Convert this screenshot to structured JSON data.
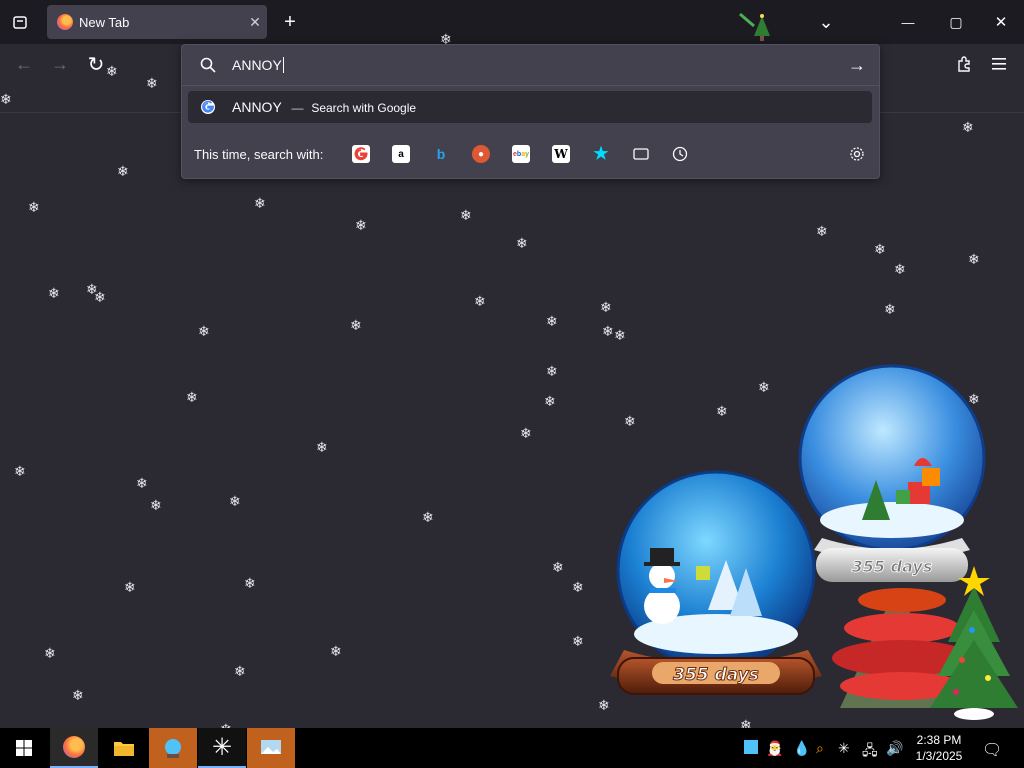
{
  "tab": {
    "title": "New Tab",
    "close": "✕",
    "new_tab": "+"
  },
  "window": {
    "list_all_tabs": "⌄",
    "minimize": "—",
    "maximize": "▢",
    "close": "✕"
  },
  "nav": {
    "back": "←",
    "forward": "→",
    "reload": "↻"
  },
  "urlbar": {
    "value": "ANNOY",
    "go": "→"
  },
  "suggestion": {
    "query": "ANNOY",
    "separator": "—",
    "action": "Search with Google"
  },
  "search_with": {
    "label": "This time, search with:",
    "engines": [
      "google-icon",
      "amazon-icon",
      "bing-icon",
      "duckduckgo-icon",
      "ebay-icon",
      "wikipedia-icon",
      "bookmarks-icon",
      "tabs-icon",
      "history-icon"
    ]
  },
  "globes": {
    "front_label": "355 days",
    "back_label": "355 days"
  },
  "taskbar": {
    "apps": [
      "windows-start-icon",
      "firefox-icon",
      "file-explorer-icon",
      "snow-globe-app-icon",
      "snowflake-app-icon",
      "snow-app-icon"
    ],
    "time": "2:38 PM",
    "date": "1/3/2025"
  },
  "colors": {
    "chrome": "#1c1b22",
    "toolbar": "#2b2a33",
    "panel": "#42414d",
    "accent": "#00ddff"
  }
}
